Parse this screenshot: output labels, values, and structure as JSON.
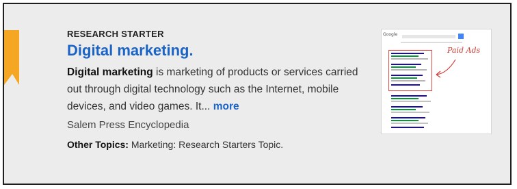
{
  "result": {
    "eyebrow": "RESEARCH STARTER",
    "title": "Digital marketing.",
    "desc_bold": "Digital marketing",
    "desc_rest": " is marketing of products or services carried out through digital technology such as the Internet, mobile devices, and video games. It...",
    "more_label": "more",
    "source": "Salem Press Encyclopedia",
    "topics_label": "Other Topics:",
    "topics_value": "Marketing: Research Starters Topic."
  },
  "thumbnail": {
    "annotation": "Paid Ads",
    "logo_text": "Google",
    "annotation_color": "#d23a32"
  },
  "colors": {
    "link": "#1a63c7",
    "ribbon": "#f5a623",
    "card_bg": "#ececec"
  }
}
